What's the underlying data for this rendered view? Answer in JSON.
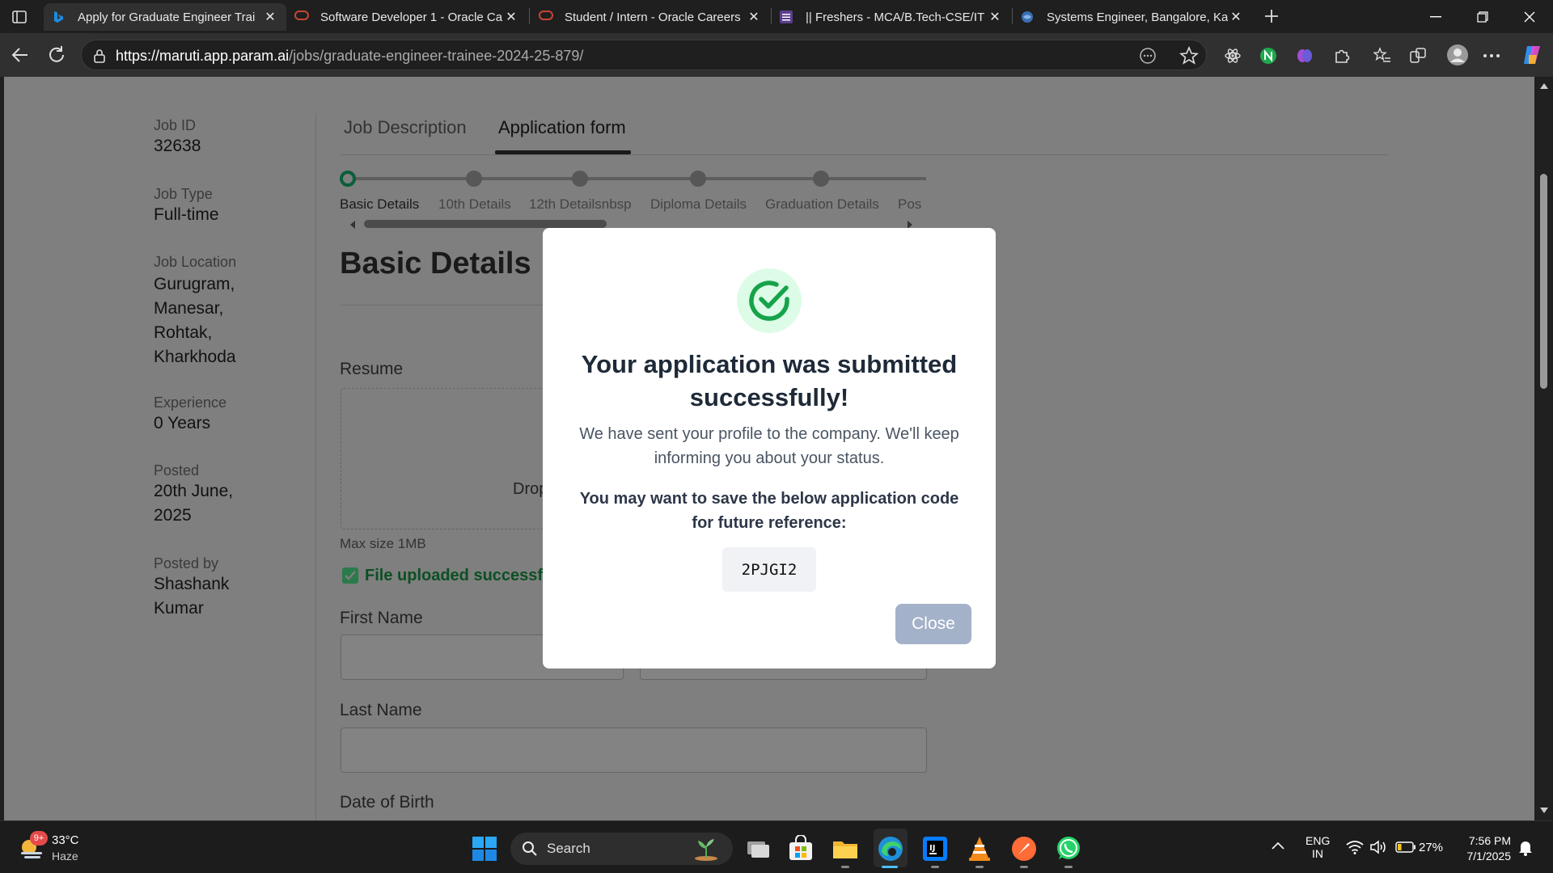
{
  "browser": {
    "tabs": [
      {
        "title": "Apply for Graduate Engineer Trai",
        "active": true
      },
      {
        "title": "Software Developer 1 - Oracle Ca"
      },
      {
        "title": "Student / Intern - Oracle Careers"
      },
      {
        "title": "|| Freshers - MCA/B.Tech-CSE/IT ||"
      },
      {
        "title": "Systems Engineer, Bangalore, Kar"
      }
    ],
    "url_host": "https://maruti.app.param.ai",
    "url_path": "/jobs/graduate-engineer-trainee-2024-25-879/"
  },
  "sidebar": {
    "job_id_label": "Job ID",
    "job_id": "32638",
    "job_type_label": "Job Type",
    "job_type": "Full-time",
    "location_label": "Job Location",
    "location_lines": [
      "Gurugram,",
      "Manesar,",
      "Rohtak,",
      "Kharkhoda"
    ],
    "experience_label": "Experience",
    "experience": "0 Years",
    "posted_label": "Posted",
    "posted_lines": [
      "20th June,",
      "2025"
    ],
    "posted_by_label": "Posted by",
    "posted_by_lines": [
      "Shashank",
      "Kumar"
    ]
  },
  "main": {
    "tabs": [
      "Job Description",
      "Application form"
    ],
    "active_tab": "Application form",
    "steps": [
      "Basic Details",
      "10th Details",
      "12th Detailsnbsp",
      "Diploma Details",
      "Graduation Details",
      "Pos"
    ],
    "section_title": "Basic Details",
    "resume_label": "Resume",
    "drop_text": "Drop",
    "max_size": "Max size 1MB",
    "upload_status": "File uploaded successfu",
    "first_name_label": "First Name",
    "last_name_label": "Last Name",
    "dob_label": "Date of Birth"
  },
  "modal": {
    "title": "Your application was submitted successfully!",
    "message": "We have sent your profile to the company. We'll keep informing you about your status.",
    "save_note": "You may want to save the below application code for future reference:",
    "code": "2PJGI2",
    "close_label": "Close",
    "check_color": "#16a34a",
    "check_bg": "#dcfce7"
  },
  "taskbar": {
    "weather_temp": "33°C",
    "weather_desc": "Haze",
    "weather_badge": "9+",
    "search_placeholder": "Search",
    "lang_line1": "ENG",
    "lang_line2": "IN",
    "battery": "27%",
    "time": "7:56 PM",
    "date": "7/1/2025"
  }
}
